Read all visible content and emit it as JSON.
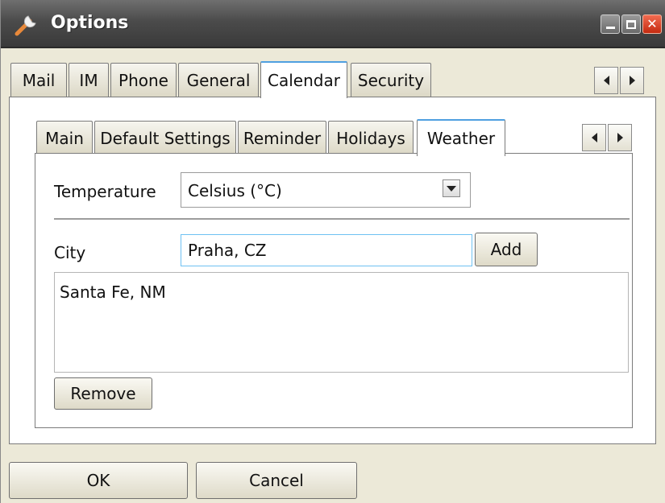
{
  "window": {
    "title": "Options",
    "icon": "wrench-icon"
  },
  "top_tabs": [
    {
      "label": "Mail"
    },
    {
      "label": "IM"
    },
    {
      "label": "Phone"
    },
    {
      "label": "General"
    },
    {
      "label": "Calendar",
      "active": true
    },
    {
      "label": "Security"
    }
  ],
  "sub_tabs": [
    {
      "label": "Main"
    },
    {
      "label": "Default Settings"
    },
    {
      "label": "Reminder"
    },
    {
      "label": "Holidays"
    },
    {
      "label": "Weather",
      "active": true
    }
  ],
  "weather": {
    "temperature_label": "Temperature",
    "temperature_value": "Celsius (°C)",
    "city_label": "City",
    "city_value": "Praha, CZ",
    "add_label": "Add",
    "cities": [
      "Santa Fe, NM"
    ],
    "remove_label": "Remove"
  },
  "footer": {
    "ok_label": "OK",
    "cancel_label": "Cancel"
  },
  "colors": {
    "dialog_bg": "#ece9d8",
    "titlebar": "#4b4b4b",
    "active_tab_accent": "#4fa0e0",
    "close_button": "#d8401f"
  }
}
